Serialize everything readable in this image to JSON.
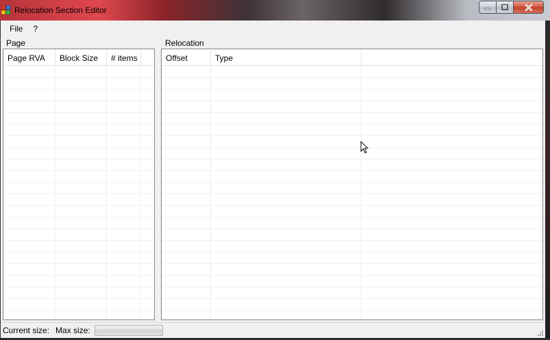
{
  "window": {
    "title": "Relocation Section Editor"
  },
  "menu": {
    "items": [
      {
        "label": "File"
      },
      {
        "label": "?"
      }
    ]
  },
  "page_panel": {
    "label": "Page",
    "columns": [
      {
        "label": "Page RVA"
      },
      {
        "label": "Block Size"
      },
      {
        "label": "# items"
      },
      {
        "label": ""
      }
    ],
    "rows": []
  },
  "relocation_panel": {
    "label": "Relocation",
    "columns": [
      {
        "label": "Offset"
      },
      {
        "label": "Type"
      },
      {
        "label": ""
      }
    ],
    "rows": []
  },
  "status": {
    "current_size_label": "Current size:",
    "max_size_label": "Max size:",
    "progress_fraction": 0
  },
  "icons": {
    "minimize": "minimize-icon",
    "maximize": "maximize-icon",
    "close": "close-icon",
    "app": "app-icon",
    "grip": "resize-grip-icon"
  },
  "colors": {
    "title_bar_accent": "#c0363c",
    "close_button": "#c13f27",
    "listview_border": "#828790",
    "gridline": "#f0f0f0"
  }
}
